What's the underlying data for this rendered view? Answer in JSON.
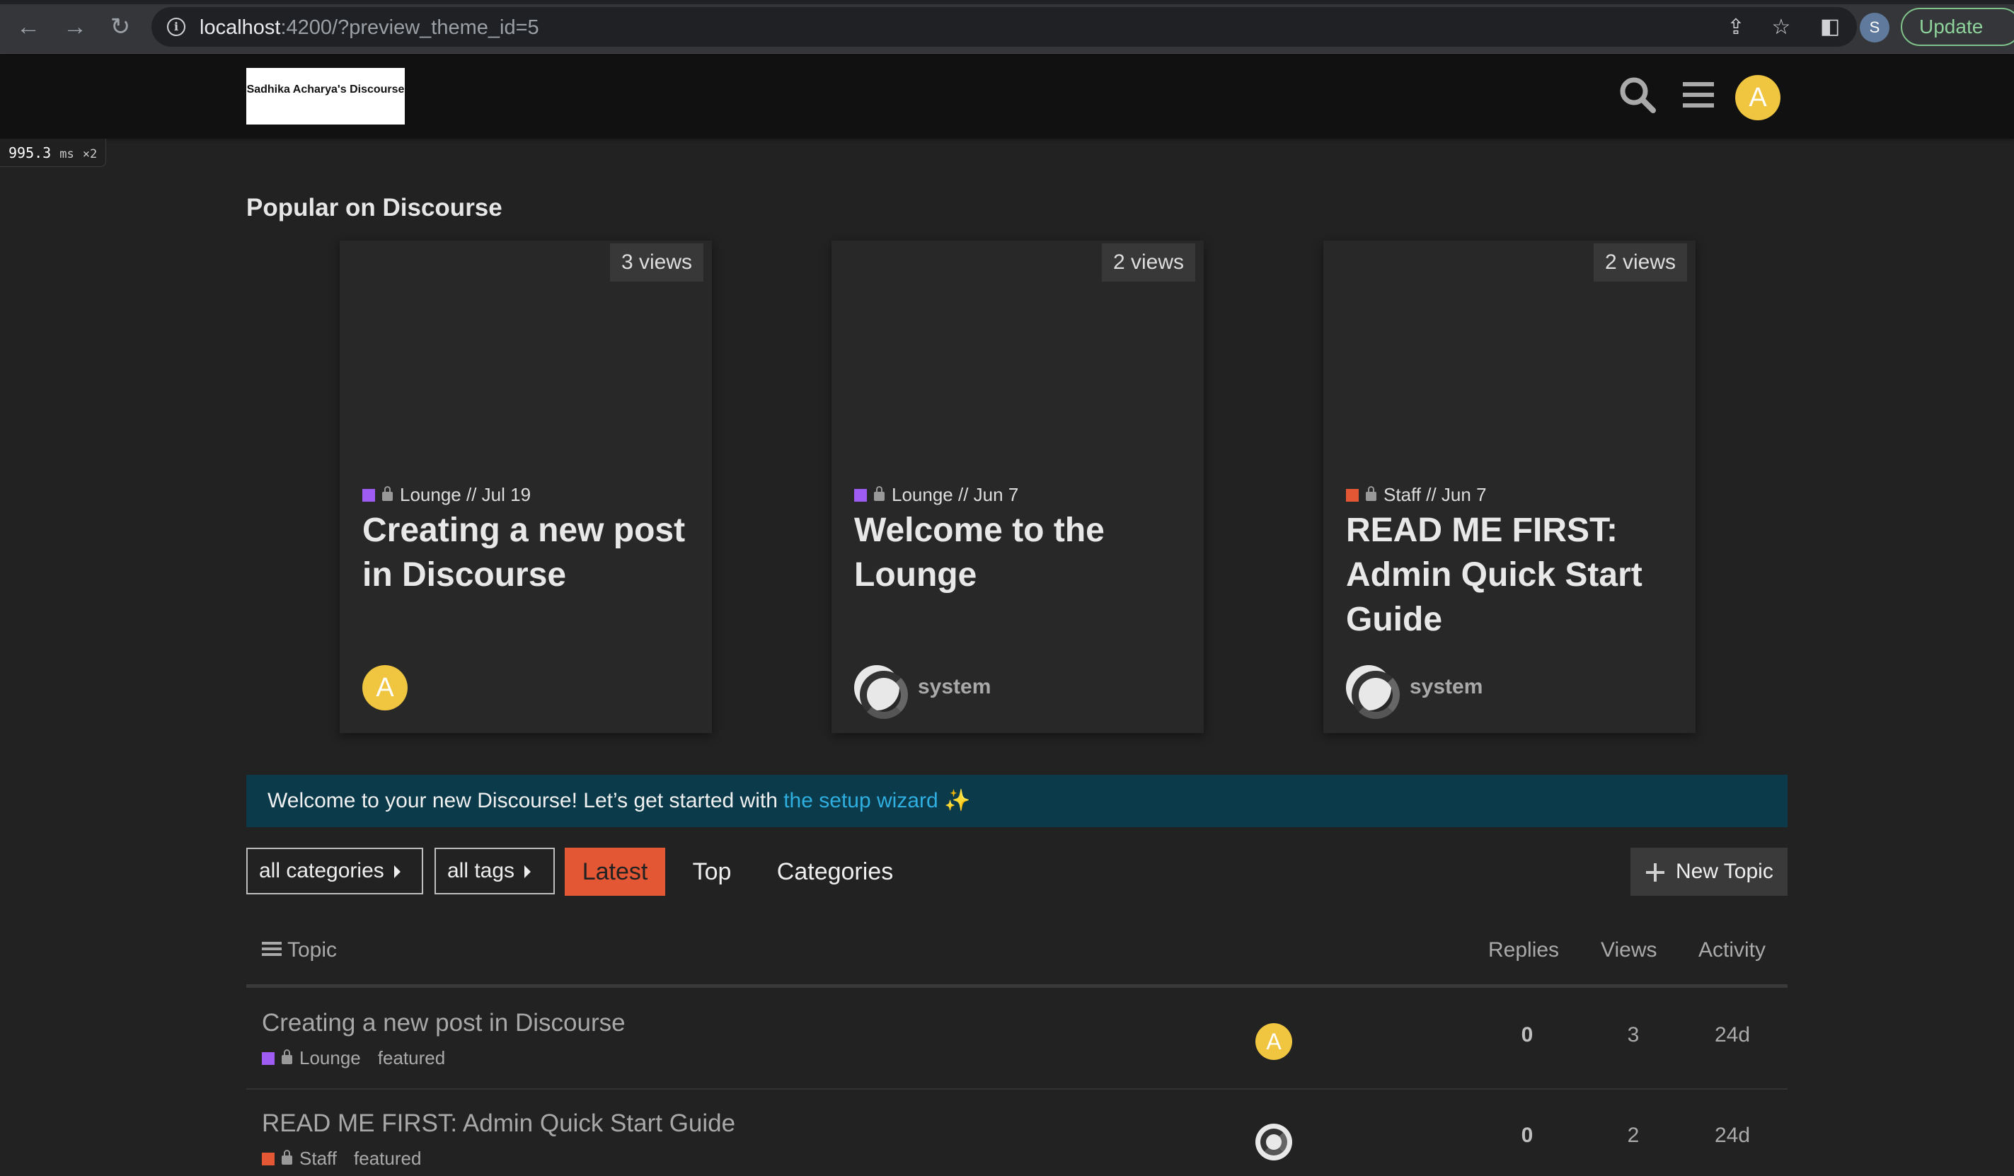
{
  "browser": {
    "url_host": "localhost",
    "url_rest": ":4200/?preview_theme_id=5",
    "profile_initial": "S",
    "update_label": "Update"
  },
  "header": {
    "logo_text": "Sadhika Acharya's Discourse",
    "user_initial": "A"
  },
  "timing": {
    "value": "995.3",
    "unit": "ms",
    "count": "×2"
  },
  "popular": {
    "title": "Popular on Discourse",
    "cards": [
      {
        "views": "3 views",
        "category": "Lounge",
        "date": "// Jul 19",
        "category_color": "#9e5cf3",
        "title": "Creating a new post in Discourse",
        "author_initial": "A",
        "author_name": ""
      },
      {
        "views": "2 views",
        "category": "Lounge",
        "date": "// Jun 7",
        "category_color": "#9e5cf3",
        "title": "Welcome to the Lounge",
        "author_initial": "",
        "author_name": "system"
      },
      {
        "views": "2 views",
        "category": "Staff",
        "date": "// Jun 7",
        "category_color": "#e45735",
        "title": "READ ME FIRST: Admin Quick Start Guide",
        "author_initial": "",
        "author_name": "system"
      }
    ]
  },
  "banner": {
    "text": "Welcome to your new Discourse! Let’s get started with ",
    "link": "the setup wizard",
    "emoji": " ✨"
  },
  "navigation": {
    "categories_dropdown": "all categories",
    "tags_dropdown": "all tags",
    "tabs": [
      "Latest",
      "Top",
      "Categories"
    ],
    "active_tab": "Latest",
    "new_topic": "New Topic"
  },
  "topic_list": {
    "headers": {
      "topic": "Topic",
      "replies": "Replies",
      "views": "Views",
      "activity": "Activity"
    },
    "rows": [
      {
        "title": "Creating a new post in Discourse",
        "category": "Lounge",
        "category_color": "#9e5cf3",
        "tag": "featured",
        "poster_initial": "A",
        "replies": "0",
        "views": "3",
        "activity": "24d"
      },
      {
        "title": "READ ME FIRST: Admin Quick Start Guide",
        "category": "Staff",
        "category_color": "#e45735",
        "tag": "featured",
        "poster_initial": "",
        "replies": "0",
        "views": "2",
        "activity": "24d"
      }
    ]
  },
  "colors": {
    "accent": "#e45735",
    "lounge": "#9e5cf3",
    "link": "#2faee0",
    "avatar": "#f0c540"
  }
}
